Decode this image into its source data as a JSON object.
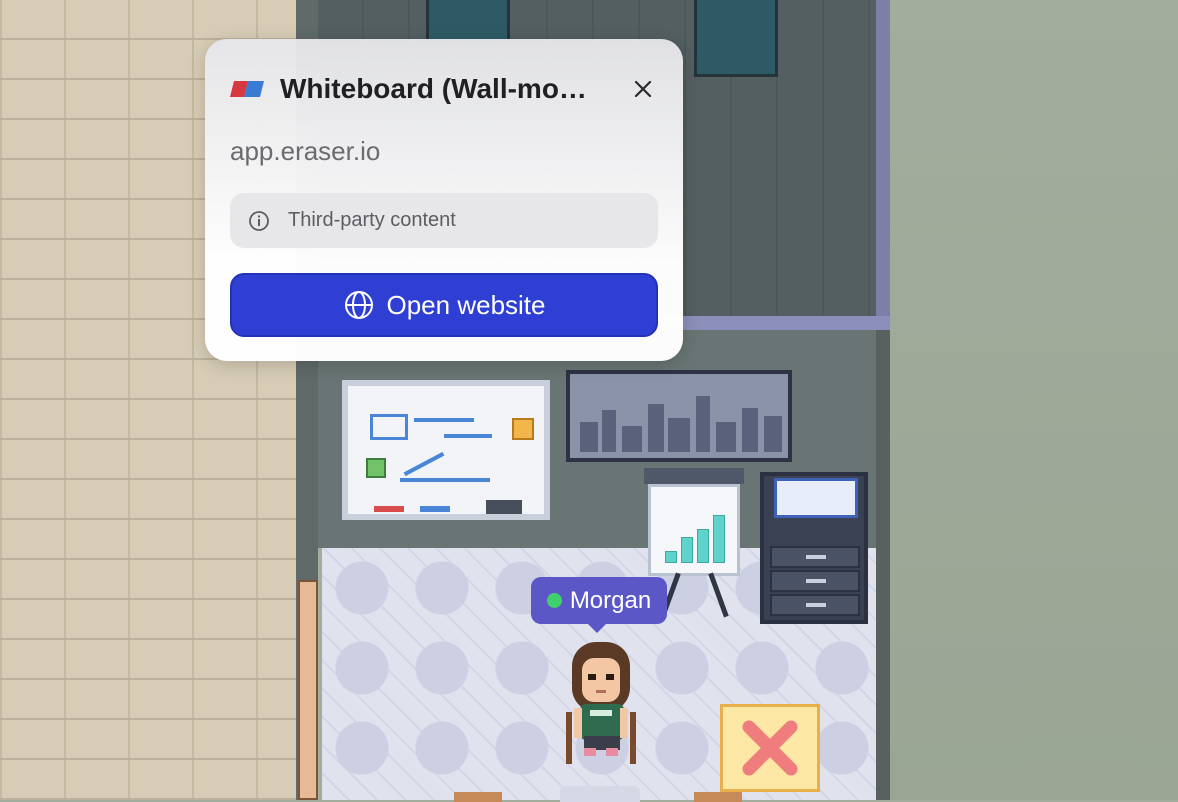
{
  "popup": {
    "app_name": "Whiteboard (Wall-mo…",
    "domain": "app.eraser.io",
    "notice": "Third-party content",
    "open_label": "Open website",
    "icons": {
      "logo": "eraser-logo-icon",
      "close": "close-icon",
      "notice": "info-icon",
      "open": "globe-icon"
    },
    "colors": {
      "accent": "#2f3fd4"
    }
  },
  "player": {
    "name": "Morgan",
    "status": "online",
    "status_color": "#3fcf6b",
    "tag_color": "#5b57c7"
  }
}
